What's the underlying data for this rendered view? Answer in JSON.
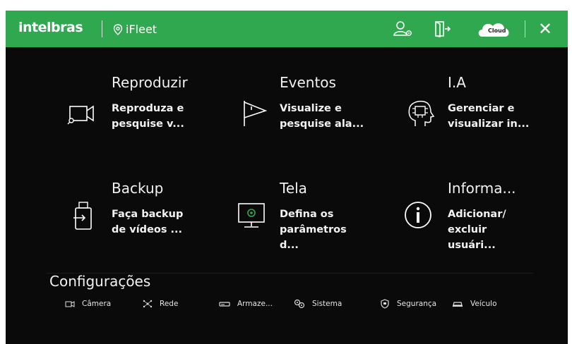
{
  "topbar": {
    "brand": "intelbras",
    "app": "iFleet",
    "cloud_label": "Cloud"
  },
  "tiles": [
    {
      "title": "Reproduzir",
      "desc": "Reproduza e pesquise v..."
    },
    {
      "title": "Eventos",
      "desc": "Visualize e pesquise ala..."
    },
    {
      "title": "I.A",
      "desc": "Gerenciar e visualizar in..."
    },
    {
      "title": "Backup",
      "desc": "Faça backup de vídeos ..."
    },
    {
      "title": "Tela",
      "desc": "Defina os parâmetros d..."
    },
    {
      "title": "Informa...",
      "desc": "Adicionar/ excluir usuári..."
    }
  ],
  "config": {
    "title": "Configurações",
    "items": [
      "Câmera",
      "Rede",
      "Armaze...",
      "Sistema",
      "Segurança",
      "Veículo"
    ]
  },
  "colors": {
    "accent": "#2fa84f",
    "background": "#0a0a0a"
  }
}
